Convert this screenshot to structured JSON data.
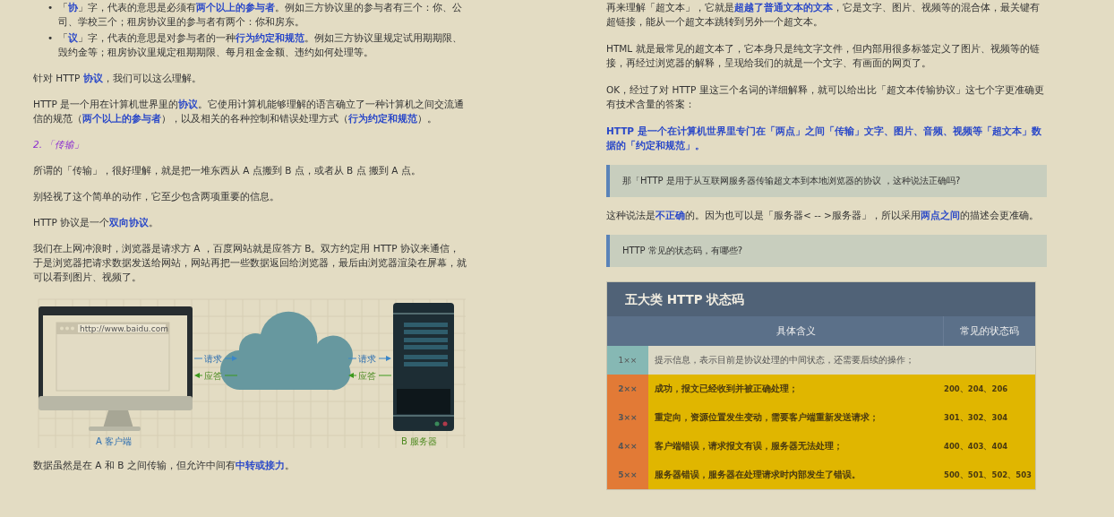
{
  "left_column": [
    {
      "kind": "bullets",
      "items": [
        {
          "marker": "•",
          "text": "「**协**」字，代表的意思是必须有**两个以上的参与者**。例如三方协议里的参与者有三个：你、公司、学校三个；租房协议里的参与者有两个：你和房东。"
        },
        {
          "marker": "•",
          "text": "「**议**」字，代表的意思是对参与者的一种**行为约定和规范**。例如三方协议里规定试用期期限、毁约金等；租房协议里规定租期期限、每月租金金额、违约如何处理等。"
        }
      ]
    },
    {
      "kind": "paragraph",
      "text": "针对 HTTP **协议**，我们可以这么理解。"
    },
    {
      "kind": "paragraph",
      "text": "HTTP 是一个用在计算机世界里的**协议**。它使用计算机能够理解的语言确立了一种计算机之间交流通信的规范（**两个以上的参与者**），以及相关的各种控制和错误处理方式（**行为约定和规范**）。"
    },
    {
      "kind": "heading",
      "text": "2. 「传输」"
    },
    {
      "kind": "paragraph",
      "text": "所谓的「传输」，很好理解，就是把一堆东西从 A 点搬到 B 点，或者从 B 点 搬到 A 点。"
    },
    {
      "kind": "paragraph",
      "text": "别轻视了这个简单的动作，它至少包含两项重要的信息。"
    },
    {
      "kind": "paragraph",
      "text": "HTTP 协议是一个**双向协议**。"
    },
    {
      "kind": "paragraph",
      "text": "我们在上网冲浪时，浏览器是请求方 A ，百度网站就是应答方 B。双方约定用 HTTP 协议来通信，于是浏览器把请求数据发送给网站，网站再把一些数据返回给浏览器，最后由浏览器渲染在屏幕，就可以看到图片、视频了。"
    },
    {
      "kind": "figure",
      "url": "http://www.baidu.com",
      "links": [
        {
          "request": "请求",
          "response": "应答"
        },
        {
          "request": "请求",
          "response": "应答"
        }
      ],
      "client_label": "A 客户端",
      "server_label": "B 服务器"
    },
    {
      "kind": "paragraph",
      "text": "数据虽然是在 A 和 B 之间传输，但允许中间有**中转或接力**。"
    }
  ],
  "right_column": [
    {
      "kind": "paragraph",
      "text": "再来理解「超文本」，它就是**超越了普通文本的文本**，它是文字、图片、视频等的混合体，最关键有超链接，能从一个超文本跳转到另外一个超文本。"
    },
    {
      "kind": "paragraph",
      "text": "HTML 就是最常见的超文本了，它本身只是纯文字文件，但内部用很多标签定义了图片、视频等的链接，再经过浏览器的解释，呈现给我们的就是一个文字、有画面的网页了。"
    },
    {
      "kind": "paragraph",
      "text": "OK，经过了对 HTTP 里这三个名词的详细解释，就可以给出比「超文本传输协议」这七个字更准确更有技术含量的答案："
    },
    {
      "kind": "emphasis",
      "text": "HTTP 是一个在计算机世界里专门在「两点」之间「传输」文字、图片、音频、视频等「超文本」数据的「约定和规范」。"
    },
    {
      "kind": "quote",
      "text": "那「HTTP 是用于从互联网服务器传输超文本到本地浏览器的协议 ，这种说法正确吗?"
    },
    {
      "kind": "paragraph",
      "text": "这种说法是**不正确**的。因为也可以是「服务器< -- >服务器」，所以采用**两点之间**的描述会更准确。"
    },
    {
      "kind": "quote",
      "text": "HTTP 常见的状态码，有哪些?"
    },
    {
      "kind": "table",
      "title": "五大类 HTTP 状态码",
      "columns": [
        "具体含义",
        "常见的状态码"
      ],
      "rows": [
        {
          "code": "1××",
          "meaning": "提示信息，表示目前是协议处理的中间状态，还需要后续的操作；",
          "examples": "",
          "color": "#86b8b4",
          "kind": "plain"
        },
        {
          "code": "2××",
          "meaning": "成功，报文已经收到并被正确处理；",
          "examples": "200、204、206",
          "color": "#e27a36",
          "kind": "highlight"
        },
        {
          "code": "3××",
          "meaning": "重定向，资源位置发生变动，需要客户端重新发送请求；",
          "examples": "301、302、304",
          "color": "#e27a36",
          "kind": "highlight"
        },
        {
          "code": "4××",
          "meaning": "客户端错误，请求报文有误，服务器无法处理；",
          "examples": "400、403、404",
          "color": "#e27a36",
          "kind": "highlight"
        },
        {
          "code": "5××",
          "meaning": "服务器错误，服务器在处理请求时内部发生了错误。",
          "examples": "500、501、502、503",
          "color": "#e27a36",
          "kind": "highlight"
        }
      ]
    }
  ]
}
